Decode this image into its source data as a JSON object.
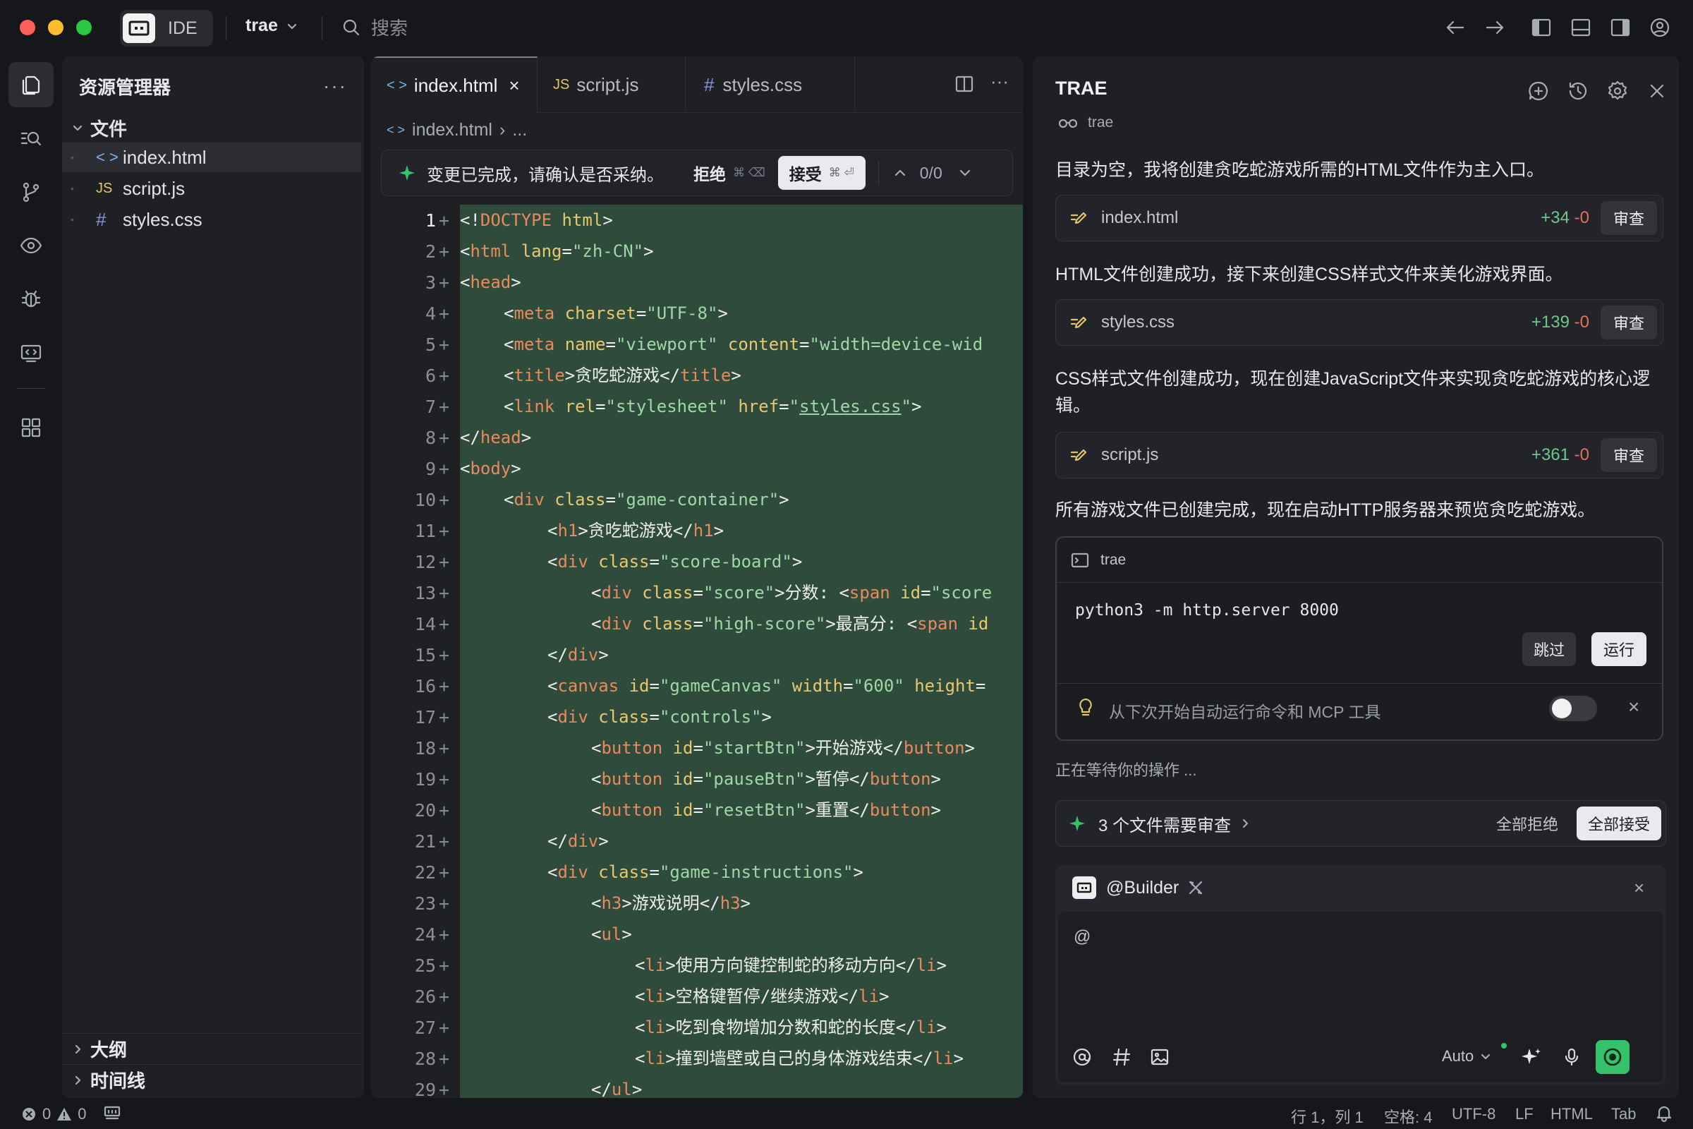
{
  "titlebar": {
    "ide_label": "IDE",
    "project": "trae",
    "search_placeholder": "搜索"
  },
  "explorer": {
    "title": "资源管理器",
    "more": "···",
    "folder": "文件",
    "files": [
      {
        "name": "index.html",
        "icon": "< >",
        "color": "#7fb3e6"
      },
      {
        "name": "script.js",
        "icon": "JS",
        "color": "#e5c46a"
      },
      {
        "name": "styles.css",
        "icon": "#",
        "color": "#8a8fe8"
      }
    ],
    "outline": "大纲",
    "timeline": "时间线"
  },
  "editor": {
    "tabs": [
      {
        "label": "index.html",
        "icon": "< >",
        "close": "×"
      },
      {
        "label": "script.js",
        "icon": "JS"
      },
      {
        "label": "styles.css",
        "icon": "#"
      }
    ],
    "breadcrumb": {
      "file": "index.html",
      "sep": "›",
      "rest": "..."
    },
    "review": {
      "message": "变更已完成，请确认是否采纳。",
      "reject": "拒绝",
      "reject_keys": "⌘ ⌫",
      "accept": "接受",
      "accept_keys": "⌘ ⏎",
      "counter": "0/0"
    },
    "lines": [
      "1",
      "2",
      "3",
      "4",
      "5",
      "6",
      "7",
      "8",
      "9",
      "10",
      "11",
      "12",
      "13",
      "14",
      "15",
      "16",
      "17",
      "18",
      "19",
      "20",
      "21",
      "22",
      "23",
      "24",
      "25",
      "26",
      "27",
      "28",
      "29"
    ],
    "plus": "+",
    "code": {
      "l1a": "<!",
      "l1b": "DOCTYPE",
      "l1c": " html",
      "l1d": ">",
      "l2a": "<",
      "l2b": "html",
      "l2c": " lang",
      "l2d": "=",
      "l2e": "\"zh-CN\"",
      "l2f": ">",
      "l3a": "<",
      "l3b": "head",
      "l3c": ">",
      "l4a": "<",
      "l4b": "meta",
      "l4c": " charset",
      "l4d": "=",
      "l4e": "\"UTF-8\"",
      "l4f": ">",
      "l5a": "<",
      "l5b": "meta",
      "l5c": " name",
      "l5d": "=",
      "l5e": "\"viewport\"",
      "l5f": " content",
      "l5g": "=",
      "l5h": "\"width=device-wid",
      "l6a": "<",
      "l6b": "title",
      "l6c": ">贪吃蛇游戏</",
      "l6d": "title",
      "l6e": ">",
      "l7a": "<",
      "l7b": "link",
      "l7c": " rel",
      "l7d": "=",
      "l7e": "\"stylesheet\"",
      "l7f": " href",
      "l7g": "=",
      "l7h": "\"",
      "l7i": "styles.css",
      "l7j": "\"",
      "l7k": ">",
      "l8a": "</",
      "l8b": "head",
      "l8c": ">",
      "l9a": "<",
      "l9b": "body",
      "l9c": ">",
      "l10a": "<",
      "l10b": "div",
      "l10c": " class",
      "l10d": "=",
      "l10e": "\"game-container\"",
      "l10f": ">",
      "l11a": "<",
      "l11b": "h1",
      "l11c": ">贪吃蛇游戏</",
      "l11d": "h1",
      "l11e": ">",
      "l12a": "<",
      "l12b": "div",
      "l12c": " class",
      "l12d": "=",
      "l12e": "\"score-board\"",
      "l12f": ">",
      "l13a": "<",
      "l13b": "div",
      "l13c": " class",
      "l13d": "=",
      "l13e": "\"score\"",
      "l13f": ">分数: <",
      "l13g": "span",
      "l13h": " id",
      "l13i": "=",
      "l13j": "\"score",
      "l14a": "<",
      "l14b": "div",
      "l14c": " class",
      "l14d": "=",
      "l14e": "\"high-score\"",
      "l14f": ">最高分: <",
      "l14g": "span",
      "l14h": " id",
      "l15a": "</",
      "l15b": "div",
      "l15c": ">",
      "l16a": "<",
      "l16b": "canvas",
      "l16c": " id",
      "l16d": "=",
      "l16e": "\"gameCanvas\"",
      "l16f": " width",
      "l16g": "=",
      "l16h": "\"600\"",
      "l16i": " height",
      "l16j": "=",
      "l17a": "<",
      "l17b": "div",
      "l17c": " class",
      "l17d": "=",
      "l17e": "\"controls\"",
      "l17f": ">",
      "l18a": "<",
      "l18b": "button",
      "l18c": " id",
      "l18d": "=",
      "l18e": "\"startBtn\"",
      "l18f": ">开始游戏</",
      "l18g": "button",
      "l18h": ">",
      "l19a": "<",
      "l19b": "button",
      "l19c": " id",
      "l19d": "=",
      "l19e": "\"pauseBtn\"",
      "l19f": ">暂停</",
      "l19g": "button",
      "l19h": ">",
      "l20a": "<",
      "l20b": "button",
      "l20c": " id",
      "l20d": "=",
      "l20e": "\"resetBtn\"",
      "l20f": ">重置</",
      "l20g": "button",
      "l20h": ">",
      "l21a": "</",
      "l21b": "div",
      "l21c": ">",
      "l22a": "<",
      "l22b": "div",
      "l22c": " class",
      "l22d": "=",
      "l22e": "\"game-instructions\"",
      "l22f": ">",
      "l23a": "<",
      "l23b": "h3",
      "l23c": ">游戏说明</",
      "l23d": "h3",
      "l23e": ">",
      "l24a": "<",
      "l24b": "ul",
      "l24c": ">",
      "l25a": "<",
      "l25b": "li",
      "l25c": ">使用方向键控制蛇的移动方向</",
      "l25d": "li",
      "l25e": ">",
      "l26a": "<",
      "l26b": "li",
      "l26c": ">空格键暂停/继续游戏</",
      "l26d": "li",
      "l26e": ">",
      "l27a": "<",
      "l27b": "li",
      "l27c": ">吃到食物增加分数和蛇的长度</",
      "l27d": "li",
      "l27e": ">",
      "l28a": "<",
      "l28b": "li",
      "l28c": ">撞到墙壁或自己的身体游戏结束</",
      "l28d": "li",
      "l28e": ">",
      "l29a": "</",
      "l29b": "ul",
      "l29c": ">"
    }
  },
  "panel": {
    "title": "TRAE",
    "agent": "trae",
    "msg1": "目录为空，我将创建贪吃蛇游戏所需的HTML文件作为主入口。",
    "file1": {
      "name": "index.html",
      "add": "+34",
      "del": "-0",
      "review": "审查"
    },
    "msg2": "HTML文件创建成功，接下来创建CSS样式文件来美化游戏界面。",
    "file2": {
      "name": "styles.css",
      "add": "+139",
      "del": "-0",
      "review": "审查"
    },
    "msg3": "CSS样式文件创建成功，现在创建JavaScript文件来实现贪吃蛇游戏的核心逻辑。",
    "file3": {
      "name": "script.js",
      "add": "+361",
      "del": "-0",
      "review": "审查"
    },
    "msg4": "所有游戏文件已创建完成，现在启动HTTP服务器来预览贪吃蛇游戏。",
    "terminal": {
      "name": "trae",
      "command": "python3 -m http.server 8000",
      "skip": "跳过",
      "run": "运行",
      "auto_run": "从下次开始自动运行命令和 MCP 工具",
      "close": "×"
    },
    "waiting": "正在等待你的操作 ...",
    "pending": {
      "text": "3 个文件需要审查",
      "reject_all": "全部拒绝",
      "accept_all": "全部接受"
    },
    "chat": {
      "agent": "@Builder",
      "close": "×",
      "input_value": "@",
      "model": "Auto"
    }
  },
  "statusbar": {
    "errors": "0",
    "warnings": "0",
    "position": "行 1，列 1",
    "spaces": "空格: 4",
    "encoding": "UTF-8",
    "eol": "LF",
    "language": "HTML",
    "tab": "Tab"
  },
  "colors": {
    "accent_green": "#36c26a",
    "diff_bg": "#2f4b3b"
  }
}
